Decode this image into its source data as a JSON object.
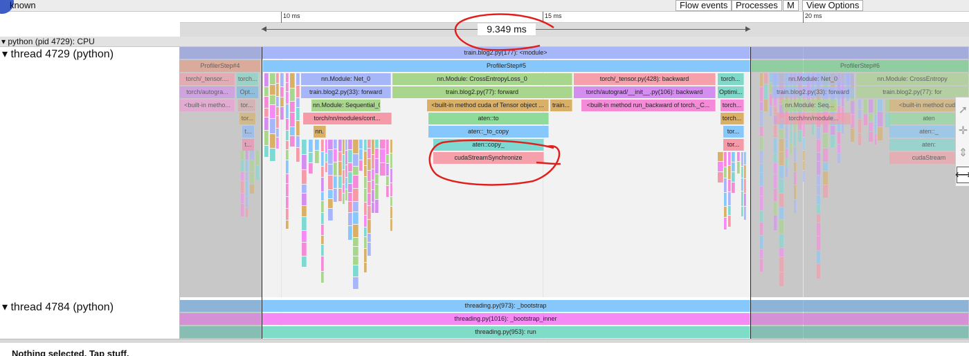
{
  "header": {
    "title": "known",
    "buttons": [
      "Flow events",
      "Processes",
      "M",
      "View Options"
    ]
  },
  "ruler": {
    "ticks": [
      "10 ms",
      "15 ms",
      "20 ms"
    ]
  },
  "measurement": {
    "label": "9.349 ms"
  },
  "process": {
    "label": "python (pid 4729): CPU"
  },
  "threads": [
    {
      "label": "thread 4729 (python)"
    },
    {
      "label": "thread 4784 (python)"
    }
  ],
  "thread_4729": {
    "top": "train.blog2.py(177): <module>",
    "steps": [
      "ProfilerStep#4",
      "ProfilerStep#5",
      "ProfilerStep#6"
    ],
    "left_stack": [
      "torch/_tensor....",
      "torch/autogra...",
      "<built-in metho...",
      "torch...",
      "Opt...",
      "tor...",
      "tor...",
      "t...",
      "t..."
    ],
    "forward_a": [
      "nn.Module: Net_0",
      "train.blog2.py(33): forward",
      "nn.Module: Sequential_0",
      "torch/nn/modules/cont...",
      "nn."
    ],
    "loss": [
      "nn.Module: CrossEntropyLoss_0",
      "train.blog2.py(77): forward",
      "<built-in method cuda of Tensor object ...",
      "aten::to",
      "aten::_to_copy",
      "aten::copy_",
      "cudaStreamSynchronize",
      "train..."
    ],
    "backward": [
      "torch/_tensor.py(428): backward",
      "torch/autograd/__init__.py(106): backward",
      "<built-in method run_backward of torch._C..."
    ],
    "opt": [
      "torch...",
      "Optimi...",
      "torch...",
      "torch...",
      "tor...",
      "tor..."
    ],
    "forward_b": [
      "nn.Module: Net_0",
      "train.blog2.py(33): forward",
      "nn.Module: Seq...",
      "torch/nn/module..."
    ],
    "loss_b": [
      "nn.Module: CrossEntropy",
      "train.blog2.py(77): for",
      "<built-in method cuda",
      "aten",
      "aten::_",
      "aten:",
      "cudaStream"
    ]
  },
  "thread_4784": {
    "rows": [
      "threading.py(973): _bootstrap",
      "threading.py(1016): _bootstrap_inner",
      "threading.py(953): run"
    ]
  },
  "status": {
    "text": "Nothing selected. Tap stuff."
  },
  "tools": [
    "pointer-icon",
    "pan-icon",
    "zoom-icon",
    "timing-icon"
  ],
  "colors": {
    "annotation": "#e0201c",
    "selection_shade": "#c8c8c8"
  }
}
